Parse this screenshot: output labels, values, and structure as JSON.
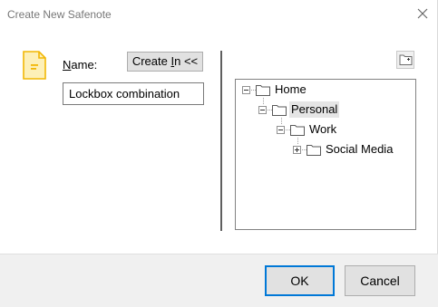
{
  "window": {
    "title": "Create New Safenote",
    "close_icon": "close-icon"
  },
  "form": {
    "name_label_mnemonic": "N",
    "name_label_rest": "ame:",
    "create_in_prefix": "Create ",
    "create_in_mnemonic": "I",
    "create_in_suffix": "n <<",
    "name_value": "Lockbox combination",
    "note_icon": "note-icon"
  },
  "tree": {
    "new_folder_icon": "new-folder-icon",
    "nodes": [
      {
        "label": "Home",
        "expanded": true,
        "selected": false
      },
      {
        "label": "Personal",
        "expanded": true,
        "selected": true
      },
      {
        "label": "Work",
        "expanded": true,
        "selected": false
      },
      {
        "label": "Social Media",
        "expanded": false,
        "selected": false
      }
    ]
  },
  "buttons": {
    "ok": "OK",
    "cancel": "Cancel"
  },
  "colors": {
    "note_icon_fill": "#fdf0b8",
    "note_icon_stroke": "#f2b705",
    "focus_border": "#0078d7"
  }
}
